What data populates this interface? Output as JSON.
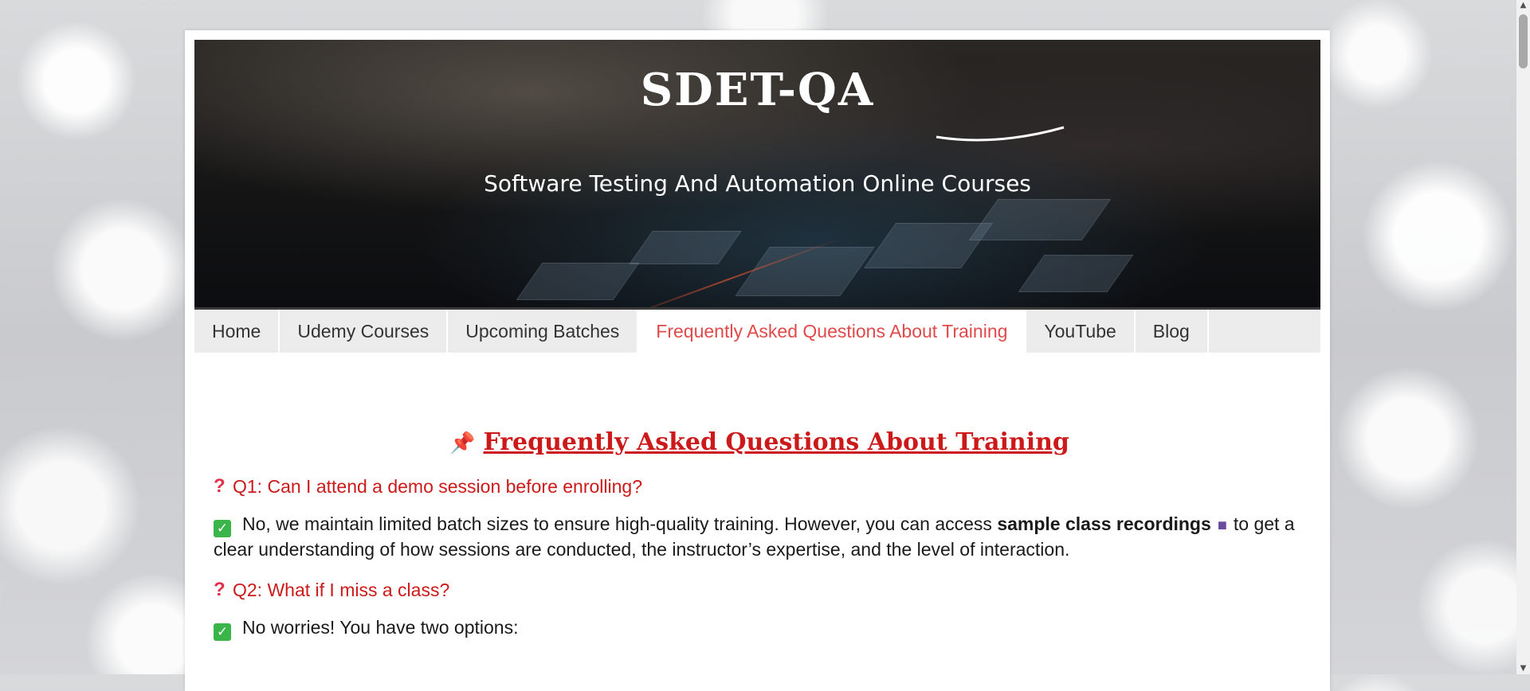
{
  "header": {
    "site_title": "SDET-QA",
    "tagline": "Software Testing And Automation Online Courses"
  },
  "nav": {
    "items": [
      {
        "label": "Home"
      },
      {
        "label": "Udemy Courses"
      },
      {
        "label": "Upcoming Batches"
      },
      {
        "label": "Frequently Asked Questions About Training",
        "active": true
      },
      {
        "label": "YouTube"
      },
      {
        "label": "Blog"
      }
    ]
  },
  "faq": {
    "heading": "Frequently Asked Questions About Training",
    "q1": {
      "question": "Q1: Can I attend a demo session before enrolling?",
      "answer_part1": "No, we maintain limited batch sizes to ensure high-quality training. However, you can access ",
      "answer_bold": "sample class recordings",
      "answer_part2": "to get a clear understanding of how sessions are conducted, the instructor’s expertise, and the level of interaction."
    },
    "q2": {
      "question": "Q2: What if I miss a class?",
      "answer": "No worries! You have two options:"
    }
  },
  "icons": {
    "pin": "pushpin-icon",
    "question": "question-mark-icon",
    "check": "check-mark-icon",
    "camera": "video-camera-icon"
  },
  "colors": {
    "accent_red": "#cc1a1a",
    "active_nav": "#e04a4a",
    "check_green": "#39b54a"
  }
}
